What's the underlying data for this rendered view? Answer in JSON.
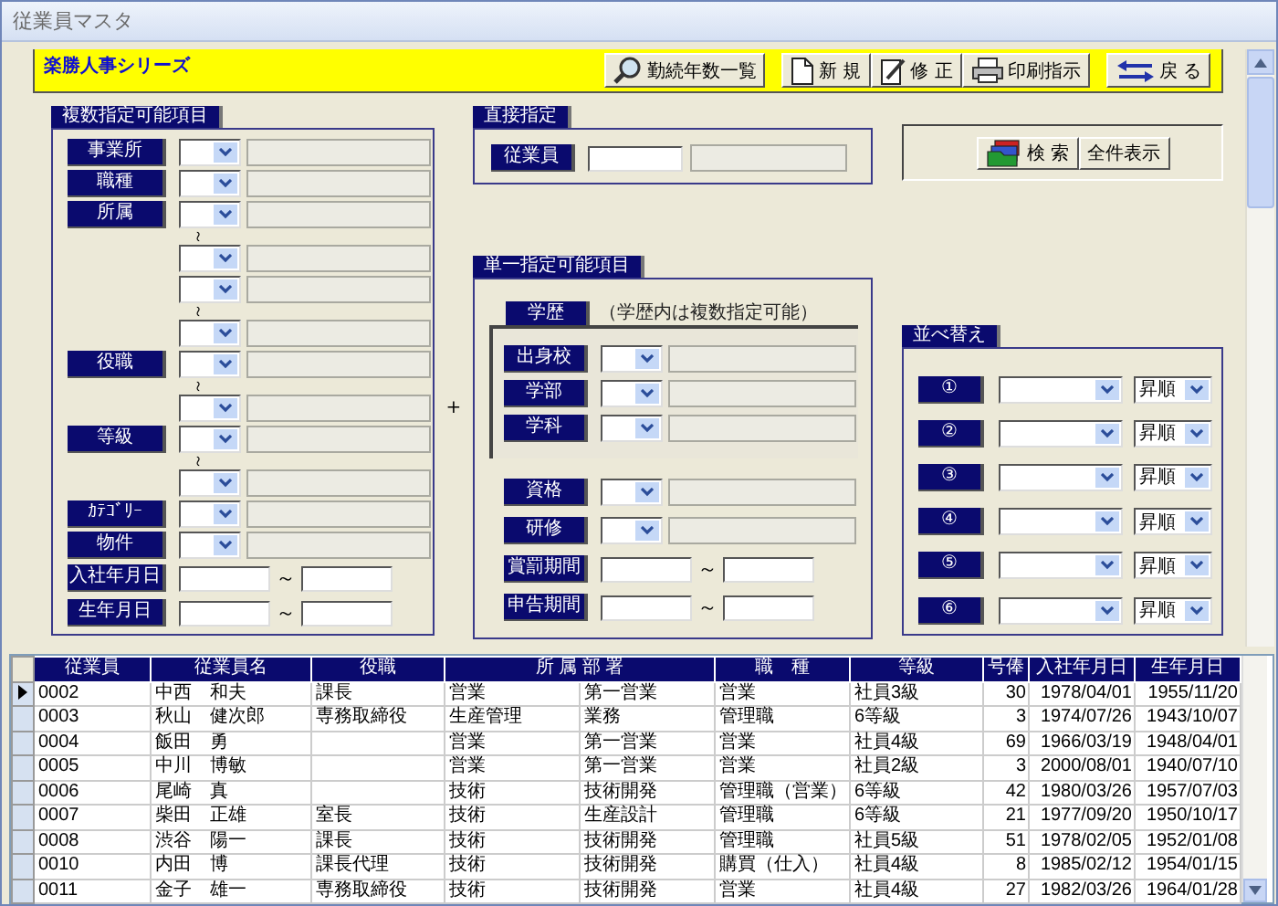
{
  "window": {
    "title": "従業員マスタ"
  },
  "toolbar": {
    "title": "楽勝人事シリーズ",
    "buttons": [
      {
        "label": "勤続年数一覧",
        "kind": "list"
      },
      {
        "label": "新 規",
        "kind": "new"
      },
      {
        "label": "修 正",
        "kind": "edit"
      },
      {
        "label": "印刷指示",
        "kind": "print"
      },
      {
        "label": "戻 る",
        "kind": "back"
      }
    ]
  },
  "multi_panel": {
    "title": "複数指定可能項目",
    "rows": [
      {
        "kind": "combo",
        "label": "事業所"
      },
      {
        "kind": "combo",
        "label": "職種"
      },
      {
        "kind": "combo",
        "label": "所属"
      },
      {
        "kind": "range_mark",
        "text": "～"
      },
      {
        "kind": "combo"
      },
      {
        "kind": "combo"
      },
      {
        "kind": "range_mark",
        "text": "～"
      },
      {
        "kind": "combo"
      },
      {
        "kind": "combo",
        "label": "役職"
      },
      {
        "kind": "range_mark",
        "text": "～"
      },
      {
        "kind": "combo"
      },
      {
        "kind": "combo",
        "label": "等級"
      },
      {
        "kind": "range_mark",
        "text": "～"
      },
      {
        "kind": "combo"
      },
      {
        "kind": "combo",
        "label": "ｶﾃｺﾞﾘｰ"
      },
      {
        "kind": "combo",
        "label": "物件"
      },
      {
        "kind": "range",
        "label": "入社年月日",
        "separator": "～"
      },
      {
        "kind": "range",
        "label": "生年月日",
        "separator": "～"
      }
    ]
  },
  "join_mark": "+",
  "direct_panel": {
    "title": "直接指定",
    "label": "従業員"
  },
  "search": {
    "buttons": [
      {
        "label": "検 索",
        "kind": "search"
      },
      {
        "label": "全件表示",
        "kind": "plain"
      }
    ]
  },
  "single_panel": {
    "title": "単一指定可能項目",
    "education": {
      "label": "学歴",
      "note": "（学歴内は複数指定可能）",
      "rows": [
        {
          "label": "出身校"
        },
        {
          "label": "学部"
        },
        {
          "label": "学科"
        }
      ]
    },
    "rows": [
      {
        "kind": "combo",
        "label": "資格"
      },
      {
        "kind": "combo",
        "label": "研修"
      },
      {
        "kind": "range",
        "label": "賞罰期間",
        "separator": "～"
      },
      {
        "kind": "range",
        "label": "申告期間",
        "separator": "～"
      }
    ]
  },
  "sort_panel": {
    "title": "並べ替え",
    "rows": [
      {
        "label": "①",
        "order": "昇順"
      },
      {
        "label": "②",
        "order": "昇順"
      },
      {
        "label": "③",
        "order": "昇順"
      },
      {
        "label": "④",
        "order": "昇順"
      },
      {
        "label": "⑤",
        "order": "昇順"
      },
      {
        "label": "⑥",
        "order": "昇順"
      }
    ]
  },
  "table": {
    "columns": [
      {
        "label": "従業員",
        "kind": "text"
      },
      {
        "label": "従業員名",
        "kind": "text"
      },
      {
        "label": "役職",
        "kind": "text"
      },
      {
        "label": "所 属 部 署",
        "kind": "text",
        "colspan": 2
      },
      {
        "label": "職　種",
        "kind": "text"
      },
      {
        "label": "等級",
        "kind": "text"
      },
      {
        "label": "号俸",
        "kind": "number"
      },
      {
        "label": "入社年月日",
        "kind": "number"
      },
      {
        "label": "生年月日",
        "kind": "number"
      }
    ],
    "rows": [
      {
        "selected": true,
        "cells": [
          "0002",
          "中西　和夫",
          "課長",
          "営業",
          "第一営業",
          "営業",
          "社員3級",
          "30",
          "1978/04/01",
          "1955/11/20"
        ]
      },
      {
        "selected": false,
        "cells": [
          "0003",
          "秋山　健次郎",
          "専務取締役",
          "生産管理",
          "業務",
          "管理職",
          "6等級",
          "3",
          "1974/07/26",
          "1943/10/07"
        ]
      },
      {
        "selected": false,
        "cells": [
          "0004",
          "飯田　勇",
          null,
          "営業",
          "第一営業",
          "営業",
          "社員4級",
          "69",
          "1966/03/19",
          "1948/04/01"
        ]
      },
      {
        "selected": false,
        "cells": [
          "0005",
          "中川　博敏",
          null,
          "営業",
          "第一営業",
          "営業",
          "社員2級",
          "3",
          "2000/08/01",
          "1940/07/10"
        ]
      },
      {
        "selected": false,
        "cells": [
          "0006",
          "尾崎　真",
          null,
          "技術",
          "技術開発",
          "管理職（営業）",
          "6等級",
          "42",
          "1980/03/26",
          "1957/07/03"
        ]
      },
      {
        "selected": false,
        "cells": [
          "0007",
          "柴田　正雄",
          "室長",
          "技術",
          "生産設計",
          "管理職",
          "6等級",
          "21",
          "1977/09/20",
          "1950/10/17"
        ]
      },
      {
        "selected": false,
        "cells": [
          "0008",
          "渋谷　陽一",
          "課長",
          "技術",
          "技術開発",
          "管理職",
          "社員5級",
          "51",
          "1978/02/05",
          "1952/01/08"
        ]
      },
      {
        "selected": false,
        "cells": [
          "0010",
          "内田　博",
          "課長代理",
          "技術",
          "技術開発",
          "購買（仕入）",
          "社員4級",
          "8",
          "1985/02/12",
          "1954/01/15"
        ]
      },
      {
        "selected": false,
        "cells": [
          "0011",
          "金子　雄一",
          "専務取締役",
          "技術",
          "技術開発",
          "営業",
          "社員4級",
          "27",
          "1982/03/26",
          "1964/01/28"
        ]
      }
    ]
  }
}
